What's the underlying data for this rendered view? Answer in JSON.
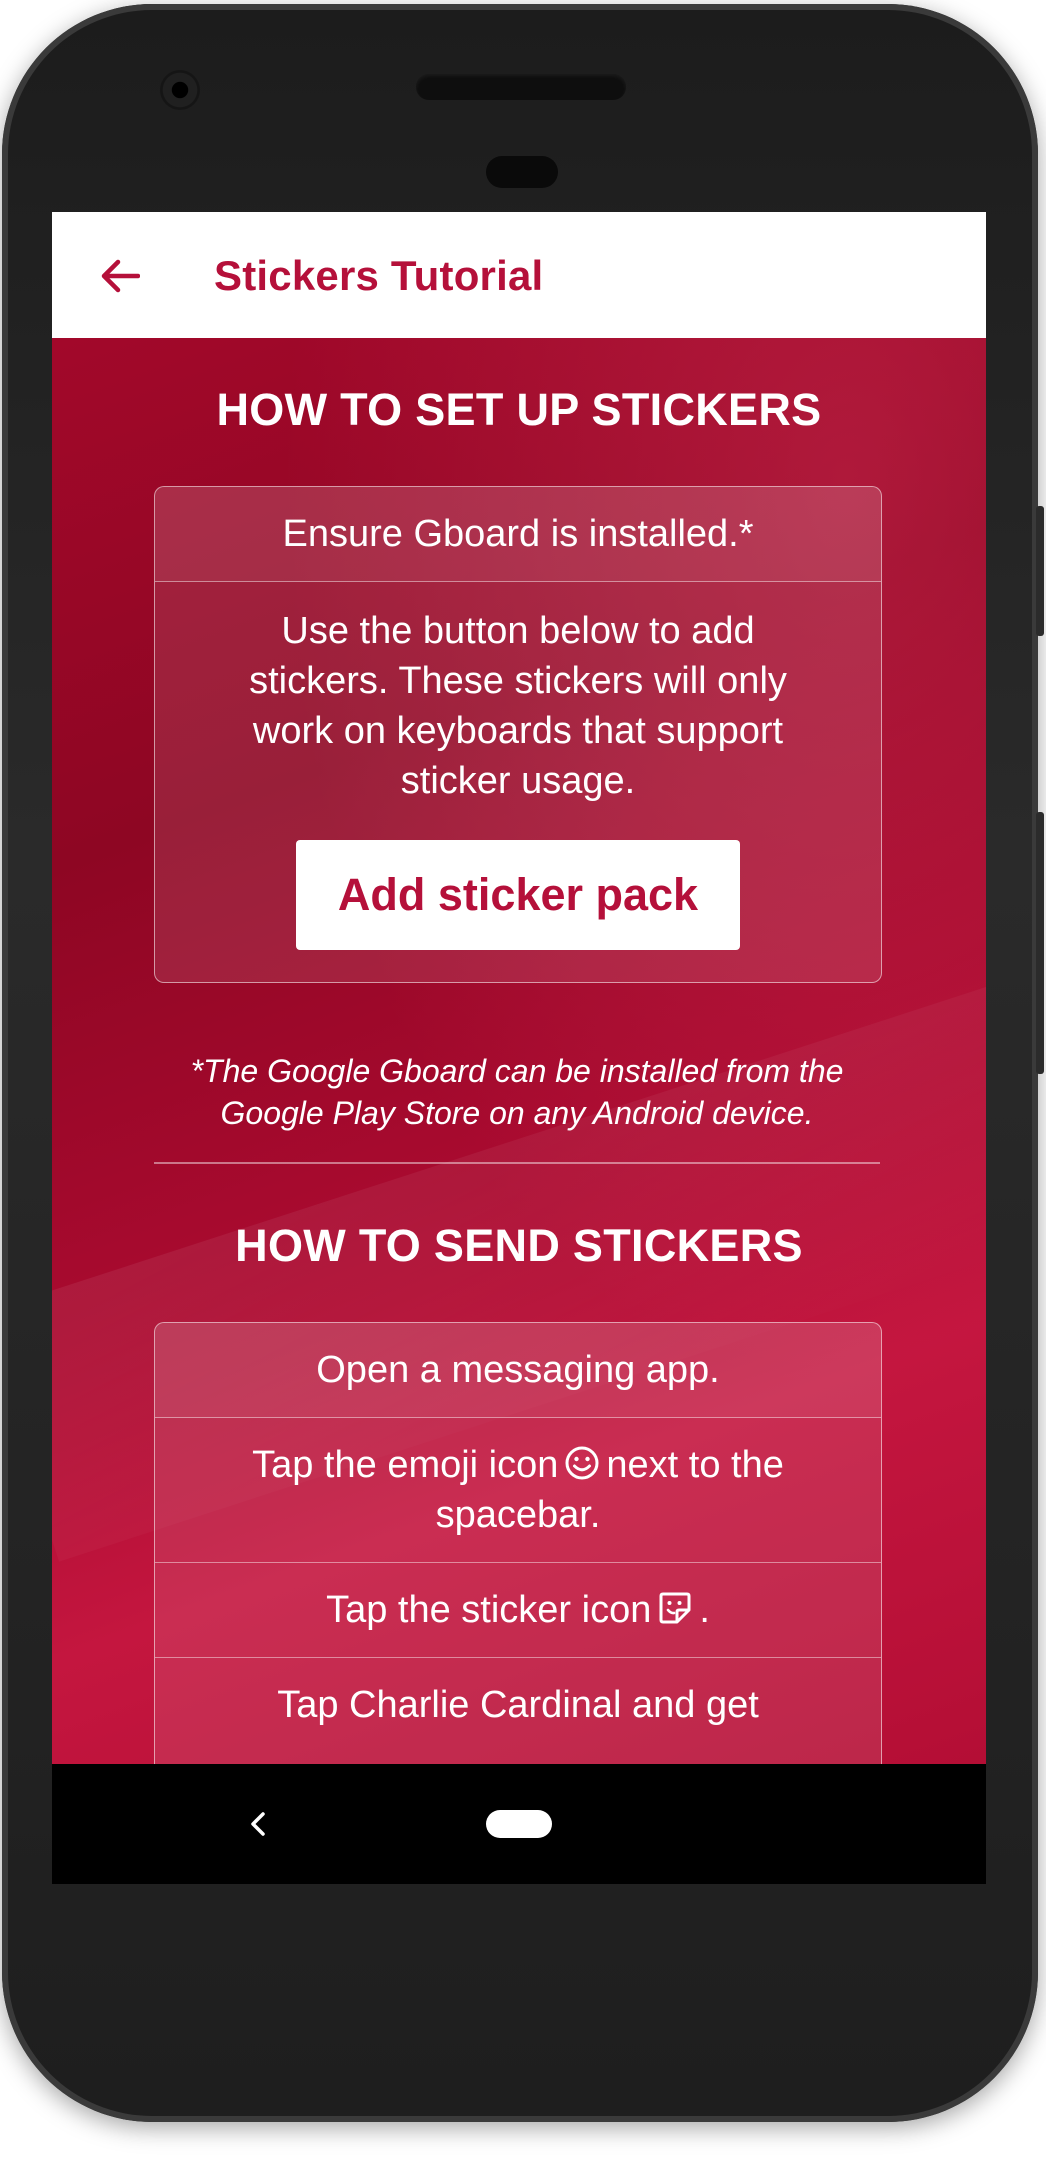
{
  "app_bar": {
    "title": "Stickers Tutorial",
    "back_icon": "arrow-left-icon",
    "accent_color": "#b5103a"
  },
  "setup_section": {
    "heading": "HOW TO SET UP STICKERS",
    "steps": [
      "Ensure Gboard is installed.*",
      "Use the button below to add stickers. These stickers will only work on keyboards that support sticker usage."
    ],
    "button_label": "Add sticker pack",
    "footnote": "*The Google Gboard can be installed from the Google Play Store on any Android device."
  },
  "send_section": {
    "heading": "HOW TO SEND STICKERS",
    "steps": [
      {
        "text": "Open a messaging app."
      },
      {
        "before": "Tap the emoji icon",
        "icon": "smiley-icon",
        "after": "next to the spacebar."
      },
      {
        "before": "Tap the sticker icon",
        "icon": "sticker-icon",
        "after": "."
      },
      {
        "text": "Tap Charlie Cardinal and get"
      }
    ]
  },
  "system_nav": {
    "back_icon": "chevron-left-icon",
    "home_icon": "home-pill-icon"
  },
  "colors": {
    "background_red": "#b50f37",
    "text_white": "#ffffff"
  }
}
